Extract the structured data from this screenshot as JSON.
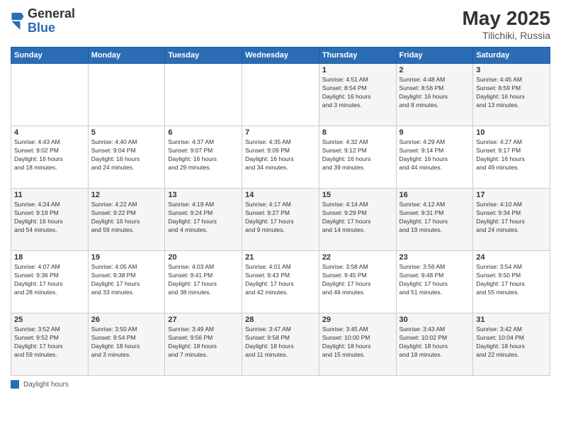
{
  "header": {
    "logo_general": "General",
    "logo_blue": "Blue",
    "title": "May 2025",
    "location": "Tilichiki, Russia"
  },
  "days_of_week": [
    "Sunday",
    "Monday",
    "Tuesday",
    "Wednesday",
    "Thursday",
    "Friday",
    "Saturday"
  ],
  "footer_legend": "Daylight hours",
  "weeks": [
    [
      {
        "day": "",
        "info": ""
      },
      {
        "day": "",
        "info": ""
      },
      {
        "day": "",
        "info": ""
      },
      {
        "day": "",
        "info": ""
      },
      {
        "day": "1",
        "info": "Sunrise: 4:51 AM\nSunset: 8:54 PM\nDaylight: 16 hours\nand 3 minutes."
      },
      {
        "day": "2",
        "info": "Sunrise: 4:48 AM\nSunset: 8:56 PM\nDaylight: 16 hours\nand 8 minutes."
      },
      {
        "day": "3",
        "info": "Sunrise: 4:45 AM\nSunset: 8:59 PM\nDaylight: 16 hours\nand 13 minutes."
      }
    ],
    [
      {
        "day": "4",
        "info": "Sunrise: 4:43 AM\nSunset: 9:02 PM\nDaylight: 16 hours\nand 18 minutes."
      },
      {
        "day": "5",
        "info": "Sunrise: 4:40 AM\nSunset: 9:04 PM\nDaylight: 16 hours\nand 24 minutes."
      },
      {
        "day": "6",
        "info": "Sunrise: 4:37 AM\nSunset: 9:07 PM\nDaylight: 16 hours\nand 29 minutes."
      },
      {
        "day": "7",
        "info": "Sunrise: 4:35 AM\nSunset: 9:09 PM\nDaylight: 16 hours\nand 34 minutes."
      },
      {
        "day": "8",
        "info": "Sunrise: 4:32 AM\nSunset: 9:12 PM\nDaylight: 16 hours\nand 39 minutes."
      },
      {
        "day": "9",
        "info": "Sunrise: 4:29 AM\nSunset: 9:14 PM\nDaylight: 16 hours\nand 44 minutes."
      },
      {
        "day": "10",
        "info": "Sunrise: 4:27 AM\nSunset: 9:17 PM\nDaylight: 16 hours\nand 49 minutes."
      }
    ],
    [
      {
        "day": "11",
        "info": "Sunrise: 4:24 AM\nSunset: 9:19 PM\nDaylight: 16 hours\nand 54 minutes."
      },
      {
        "day": "12",
        "info": "Sunrise: 4:22 AM\nSunset: 9:22 PM\nDaylight: 16 hours\nand 59 minutes."
      },
      {
        "day": "13",
        "info": "Sunrise: 4:19 AM\nSunset: 9:24 PM\nDaylight: 17 hours\nand 4 minutes."
      },
      {
        "day": "14",
        "info": "Sunrise: 4:17 AM\nSunset: 9:27 PM\nDaylight: 17 hours\nand 9 minutes."
      },
      {
        "day": "15",
        "info": "Sunrise: 4:14 AM\nSunset: 9:29 PM\nDaylight: 17 hours\nand 14 minutes."
      },
      {
        "day": "16",
        "info": "Sunrise: 4:12 AM\nSunset: 9:31 PM\nDaylight: 17 hours\nand 19 minutes."
      },
      {
        "day": "17",
        "info": "Sunrise: 4:10 AM\nSunset: 9:34 PM\nDaylight: 17 hours\nand 24 minutes."
      }
    ],
    [
      {
        "day": "18",
        "info": "Sunrise: 4:07 AM\nSunset: 9:36 PM\nDaylight: 17 hours\nand 28 minutes."
      },
      {
        "day": "19",
        "info": "Sunrise: 4:05 AM\nSunset: 9:38 PM\nDaylight: 17 hours\nand 33 minutes."
      },
      {
        "day": "20",
        "info": "Sunrise: 4:03 AM\nSunset: 9:41 PM\nDaylight: 17 hours\nand 38 minutes."
      },
      {
        "day": "21",
        "info": "Sunrise: 4:01 AM\nSunset: 9:43 PM\nDaylight: 17 hours\nand 42 minutes."
      },
      {
        "day": "22",
        "info": "Sunrise: 3:58 AM\nSunset: 9:45 PM\nDaylight: 17 hours\nand 46 minutes."
      },
      {
        "day": "23",
        "info": "Sunrise: 3:56 AM\nSunset: 9:48 PM\nDaylight: 17 hours\nand 51 minutes."
      },
      {
        "day": "24",
        "info": "Sunrise: 3:54 AM\nSunset: 9:50 PM\nDaylight: 17 hours\nand 55 minutes."
      }
    ],
    [
      {
        "day": "25",
        "info": "Sunrise: 3:52 AM\nSunset: 9:52 PM\nDaylight: 17 hours\nand 59 minutes."
      },
      {
        "day": "26",
        "info": "Sunrise: 3:50 AM\nSunset: 9:54 PM\nDaylight: 18 hours\nand 3 minutes."
      },
      {
        "day": "27",
        "info": "Sunrise: 3:49 AM\nSunset: 9:56 PM\nDaylight: 18 hours\nand 7 minutes."
      },
      {
        "day": "28",
        "info": "Sunrise: 3:47 AM\nSunset: 9:58 PM\nDaylight: 18 hours\nand 11 minutes."
      },
      {
        "day": "29",
        "info": "Sunrise: 3:45 AM\nSunset: 10:00 PM\nDaylight: 18 hours\nand 15 minutes."
      },
      {
        "day": "30",
        "info": "Sunrise: 3:43 AM\nSunset: 10:02 PM\nDaylight: 18 hours\nand 18 minutes."
      },
      {
        "day": "31",
        "info": "Sunrise: 3:42 AM\nSunset: 10:04 PM\nDaylight: 18 hours\nand 22 minutes."
      }
    ]
  ]
}
